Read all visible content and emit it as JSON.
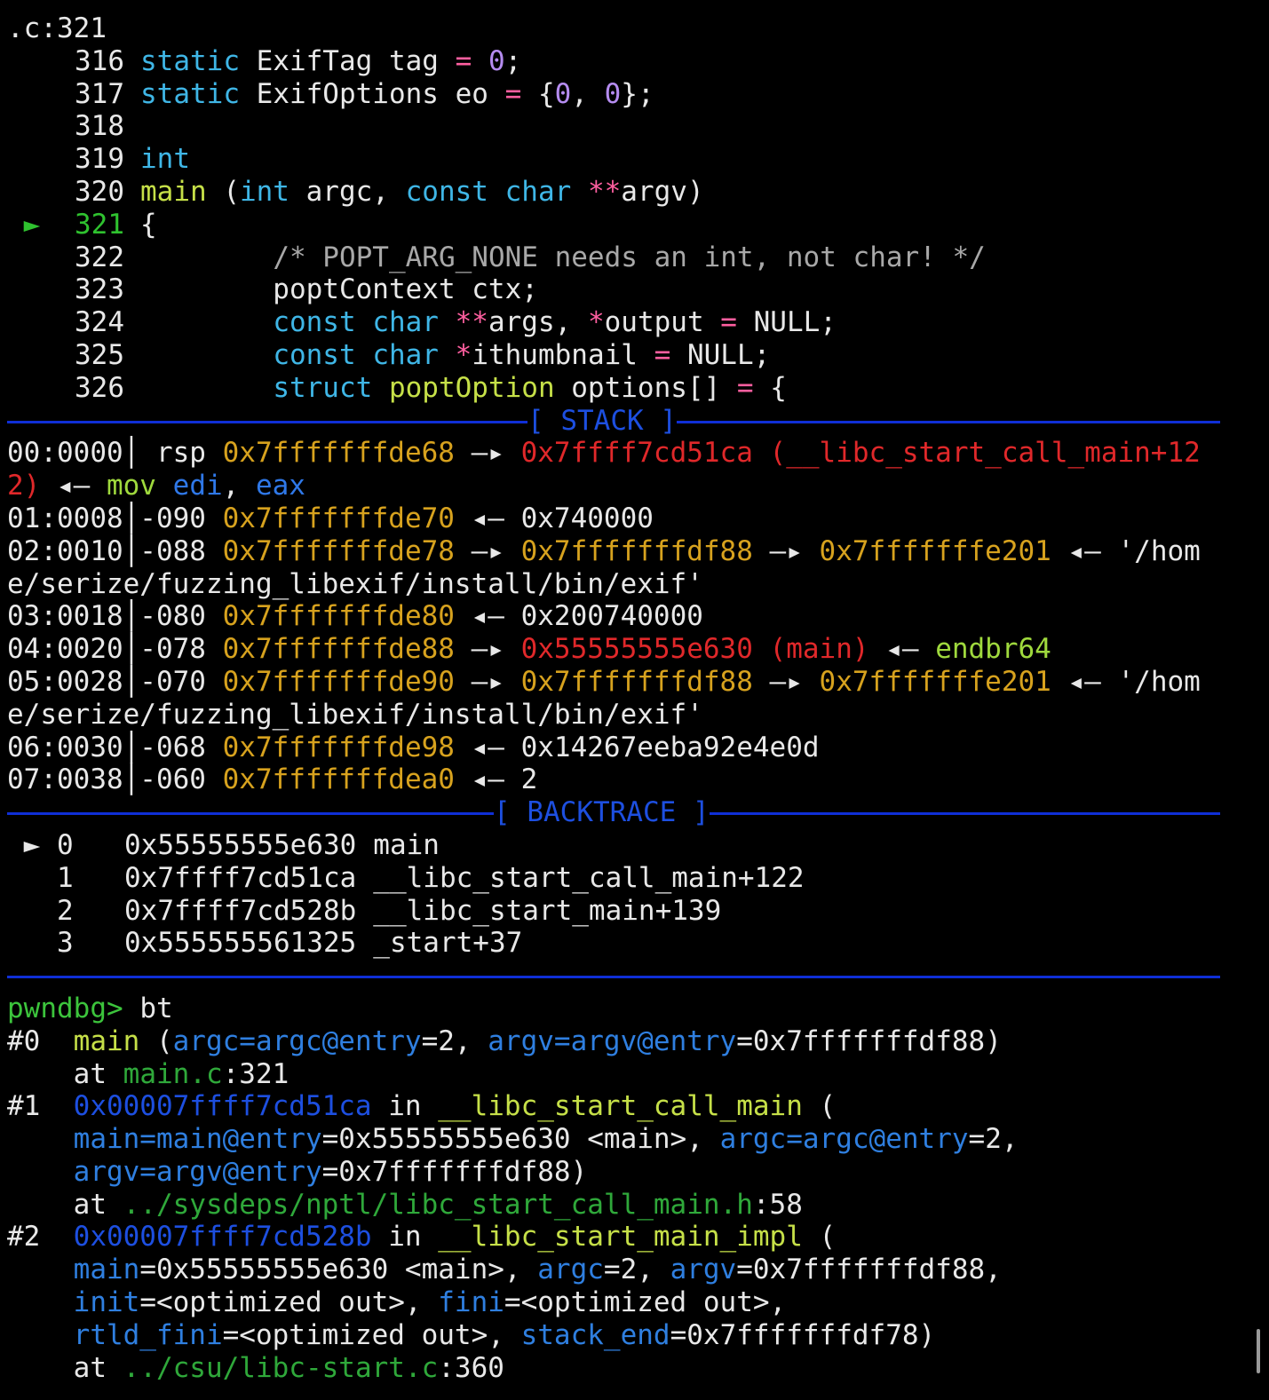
{
  "colors": {
    "default": "#e8e8e8",
    "keyword": "#3fb6e6",
    "operator": "#ff5fa0",
    "number": "#b58cf0",
    "function": "#c6e048",
    "comment": "#a8a8a8",
    "marker": "#2fc22f",
    "address": "#d7a21e",
    "code_addr": "#e0282a",
    "instruction": "#9fd93d",
    "register": "#2f78e8",
    "blue": "#1d4fe0",
    "arg": "#2f7fe0",
    "file": "#2fa83a",
    "prompt": "#3cc43c",
    "divider": "#0f2fd6"
  },
  "source": {
    "file_line": ".c:321",
    "lines": [
      {
        "marker": "",
        "num": "316",
        "segments": [
          {
            "t": "static ",
            "c": "keyword"
          },
          {
            "t": "ExifTag tag ",
            "c": "default"
          },
          {
            "t": "=",
            "c": "operator"
          },
          {
            "t": " ",
            "c": "default"
          },
          {
            "t": "0",
            "c": "number"
          },
          {
            "t": ";",
            "c": "default"
          }
        ]
      },
      {
        "marker": "",
        "num": "317",
        "segments": [
          {
            "t": "static ",
            "c": "keyword"
          },
          {
            "t": "ExifOptions eo ",
            "c": "default"
          },
          {
            "t": "=",
            "c": "operator"
          },
          {
            "t": " {",
            "c": "default"
          },
          {
            "t": "0",
            "c": "number"
          },
          {
            "t": ", ",
            "c": "default"
          },
          {
            "t": "0",
            "c": "number"
          },
          {
            "t": "};",
            "c": "default"
          }
        ]
      },
      {
        "marker": "",
        "num": "318",
        "segments": []
      },
      {
        "marker": "",
        "num": "319",
        "segments": [
          {
            "t": "int",
            "c": "keyword"
          }
        ]
      },
      {
        "marker": "",
        "num": "320",
        "segments": [
          {
            "t": "main",
            "c": "function"
          },
          {
            "t": " (",
            "c": "default"
          },
          {
            "t": "int",
            "c": "keyword"
          },
          {
            "t": " argc, ",
            "c": "default"
          },
          {
            "t": "const",
            "c": "keyword"
          },
          {
            "t": " ",
            "c": "default"
          },
          {
            "t": "char",
            "c": "keyword"
          },
          {
            "t": " ",
            "c": "default"
          },
          {
            "t": "**",
            "c": "operator"
          },
          {
            "t": "argv)",
            "c": "default"
          }
        ]
      },
      {
        "marker": "►",
        "num": "321",
        "segments": [
          {
            "t": "{",
            "c": "default"
          }
        ]
      },
      {
        "marker": "",
        "num": "322",
        "segments": [
          {
            "t": "        ",
            "c": "default"
          },
          {
            "t": "/* POPT_ARG_NONE needs an int, not char! */",
            "c": "comment"
          }
        ]
      },
      {
        "marker": "",
        "num": "323",
        "segments": [
          {
            "t": "        poptContext ctx;",
            "c": "default"
          }
        ]
      },
      {
        "marker": "",
        "num": "324",
        "segments": [
          {
            "t": "        ",
            "c": "default"
          },
          {
            "t": "const",
            "c": "keyword"
          },
          {
            "t": " ",
            "c": "default"
          },
          {
            "t": "char",
            "c": "keyword"
          },
          {
            "t": " ",
            "c": "default"
          },
          {
            "t": "**",
            "c": "operator"
          },
          {
            "t": "args, ",
            "c": "default"
          },
          {
            "t": "*",
            "c": "operator"
          },
          {
            "t": "output ",
            "c": "default"
          },
          {
            "t": "=",
            "c": "operator"
          },
          {
            "t": " NULL;",
            "c": "default"
          }
        ]
      },
      {
        "marker": "",
        "num": "325",
        "segments": [
          {
            "t": "        ",
            "c": "default"
          },
          {
            "t": "const",
            "c": "keyword"
          },
          {
            "t": " ",
            "c": "default"
          },
          {
            "t": "char",
            "c": "keyword"
          },
          {
            "t": " ",
            "c": "default"
          },
          {
            "t": "*",
            "c": "operator"
          },
          {
            "t": "ithumbnail ",
            "c": "default"
          },
          {
            "t": "=",
            "c": "operator"
          },
          {
            "t": " NULL;",
            "c": "default"
          }
        ]
      },
      {
        "marker": "",
        "num": "326",
        "segments": [
          {
            "t": "        ",
            "c": "default"
          },
          {
            "t": "struct",
            "c": "keyword"
          },
          {
            "t": " ",
            "c": "default"
          },
          {
            "t": "poptOption",
            "c": "function"
          },
          {
            "t": " options[] ",
            "c": "default"
          },
          {
            "t": "=",
            "c": "operator"
          },
          {
            "t": " {",
            "c": "default"
          }
        ]
      }
    ]
  },
  "stack": {
    "title": "[ STACK ]",
    "lines": [
      [
        {
          "t": "00:0000│ rsp ",
          "c": "default"
        },
        {
          "t": "0x7fffffffde68",
          "c": "address"
        },
        {
          "t": " —▸ ",
          "c": "default"
        },
        {
          "t": "0x7ffff7cd51ca (__libc_start_call_main+12",
          "c": "code_addr"
        }
      ],
      [
        {
          "t": "2)",
          "c": "code_addr"
        },
        {
          "t": " ◂— ",
          "c": "default"
        },
        {
          "t": "mov",
          "c": "instruction"
        },
        {
          "t": " ",
          "c": "default"
        },
        {
          "t": "edi",
          "c": "register"
        },
        {
          "t": ", ",
          "c": "default"
        },
        {
          "t": "eax",
          "c": "register"
        }
      ],
      [
        {
          "t": "01:0008│-090 ",
          "c": "default"
        },
        {
          "t": "0x7fffffffde70",
          "c": "address"
        },
        {
          "t": " ◂— 0x740000",
          "c": "default"
        }
      ],
      [
        {
          "t": "02:0010│-088 ",
          "c": "default"
        },
        {
          "t": "0x7fffffffde78",
          "c": "address"
        },
        {
          "t": " —▸ ",
          "c": "default"
        },
        {
          "t": "0x7fffffffdf88",
          "c": "address"
        },
        {
          "t": " —▸ ",
          "c": "default"
        },
        {
          "t": "0x7fffffffe201",
          "c": "address"
        },
        {
          "t": " ◂— '/hom",
          "c": "default"
        }
      ],
      [
        {
          "t": "e/serize/fuzzing_libexif/install/bin/exif'",
          "c": "default"
        }
      ],
      [
        {
          "t": "03:0018│-080 ",
          "c": "default"
        },
        {
          "t": "0x7fffffffde80",
          "c": "address"
        },
        {
          "t": " ◂— 0x200740000",
          "c": "default"
        }
      ],
      [
        {
          "t": "04:0020│-078 ",
          "c": "default"
        },
        {
          "t": "0x7fffffffde88",
          "c": "address"
        },
        {
          "t": " —▸ ",
          "c": "default"
        },
        {
          "t": "0x55555555e630 (main)",
          "c": "code_addr"
        },
        {
          "t": " ◂— ",
          "c": "default"
        },
        {
          "t": "endbr64",
          "c": "instruction"
        }
      ],
      [
        {
          "t": "05:0028│-070 ",
          "c": "default"
        },
        {
          "t": "0x7fffffffde90",
          "c": "address"
        },
        {
          "t": " —▸ ",
          "c": "default"
        },
        {
          "t": "0x7fffffffdf88",
          "c": "address"
        },
        {
          "t": " —▸ ",
          "c": "default"
        },
        {
          "t": "0x7fffffffe201",
          "c": "address"
        },
        {
          "t": " ◂— '/hom",
          "c": "default"
        }
      ],
      [
        {
          "t": "e/serize/fuzzing_libexif/install/bin/exif'",
          "c": "default"
        }
      ],
      [
        {
          "t": "06:0030│-068 ",
          "c": "default"
        },
        {
          "t": "0x7fffffffde98",
          "c": "address"
        },
        {
          "t": " ◂— 0x14267eeba92e4e0d",
          "c": "default"
        }
      ],
      [
        {
          "t": "07:0038│-060 ",
          "c": "default"
        },
        {
          "t": "0x7fffffffdea0",
          "c": "address"
        },
        {
          "t": " ◂— 2",
          "c": "default"
        }
      ]
    ]
  },
  "backtrace": {
    "title": "[ BACKTRACE ]",
    "frames": [
      {
        "marker": "►",
        "index": "0",
        "addr": "0x55555555e630",
        "symbol": "main"
      },
      {
        "marker": "",
        "index": "1",
        "addr": "0x7ffff7cd51ca",
        "symbol": "__libc_start_call_main+122"
      },
      {
        "marker": "",
        "index": "2",
        "addr": "0x7ffff7cd528b",
        "symbol": "__libc_start_main+139"
      },
      {
        "marker": "",
        "index": "3",
        "addr": "0x555555561325",
        "symbol": "_start+37"
      }
    ]
  },
  "console": {
    "prompt": "pwndbg>",
    "command": " bt",
    "lines": [
      [
        {
          "t": "#0  ",
          "c": "default"
        },
        {
          "t": "main",
          "c": "function"
        },
        {
          "t": " (",
          "c": "default"
        },
        {
          "t": "argc=argc@entry",
          "c": "arg"
        },
        {
          "t": "=2, ",
          "c": "default"
        },
        {
          "t": "argv=argv@entry",
          "c": "arg"
        },
        {
          "t": "=0x7fffffffdf88)",
          "c": "default"
        }
      ],
      [
        {
          "t": "    at ",
          "c": "default"
        },
        {
          "t": "main.c",
          "c": "file"
        },
        {
          "t": ":321",
          "c": "default"
        }
      ],
      [
        {
          "t": "#1  ",
          "c": "default"
        },
        {
          "t": "0x00007ffff7cd51ca",
          "c": "blue"
        },
        {
          "t": " in ",
          "c": "default"
        },
        {
          "t": "__libc_start_call_main",
          "c": "function"
        },
        {
          "t": " (",
          "c": "default"
        }
      ],
      [
        {
          "t": "    ",
          "c": "default"
        },
        {
          "t": "main=main@entry",
          "c": "arg"
        },
        {
          "t": "=0x55555555e630 <main>, ",
          "c": "default"
        },
        {
          "t": "argc=argc@entry",
          "c": "arg"
        },
        {
          "t": "=2,",
          "c": "default"
        }
      ],
      [
        {
          "t": "    ",
          "c": "default"
        },
        {
          "t": "argv=argv@entry",
          "c": "arg"
        },
        {
          "t": "=0x7fffffffdf88)",
          "c": "default"
        }
      ],
      [
        {
          "t": "    at ",
          "c": "default"
        },
        {
          "t": "../sysdeps/nptl/libc_start_call_main.h",
          "c": "file"
        },
        {
          "t": ":58",
          "c": "default"
        }
      ],
      [
        {
          "t": "#2  ",
          "c": "default"
        },
        {
          "t": "0x00007ffff7cd528b",
          "c": "blue"
        },
        {
          "t": " in ",
          "c": "default"
        },
        {
          "t": "__libc_start_main_impl",
          "c": "function"
        },
        {
          "t": " (",
          "c": "default"
        }
      ],
      [
        {
          "t": "    ",
          "c": "default"
        },
        {
          "t": "main",
          "c": "arg"
        },
        {
          "t": "=0x55555555e630 <main>, ",
          "c": "default"
        },
        {
          "t": "argc",
          "c": "arg"
        },
        {
          "t": "=2, ",
          "c": "default"
        },
        {
          "t": "argv",
          "c": "arg"
        },
        {
          "t": "=0x7fffffffdf88,",
          "c": "default"
        }
      ],
      [
        {
          "t": "    ",
          "c": "default"
        },
        {
          "t": "init",
          "c": "arg"
        },
        {
          "t": "=<optimized out>, ",
          "c": "default"
        },
        {
          "t": "fini",
          "c": "arg"
        },
        {
          "t": "=<optimized out>,",
          "c": "default"
        }
      ],
      [
        {
          "t": "    ",
          "c": "default"
        },
        {
          "t": "rtld_fini",
          "c": "arg"
        },
        {
          "t": "=<optimized out>, ",
          "c": "default"
        },
        {
          "t": "stack_end",
          "c": "arg"
        },
        {
          "t": "=0x7fffffffdf78)",
          "c": "default"
        }
      ],
      [
        {
          "t": "    at ",
          "c": "default"
        },
        {
          "t": "../csu/libc-start.c",
          "c": "file"
        },
        {
          "t": ":360",
          "c": "default"
        }
      ]
    ]
  }
}
